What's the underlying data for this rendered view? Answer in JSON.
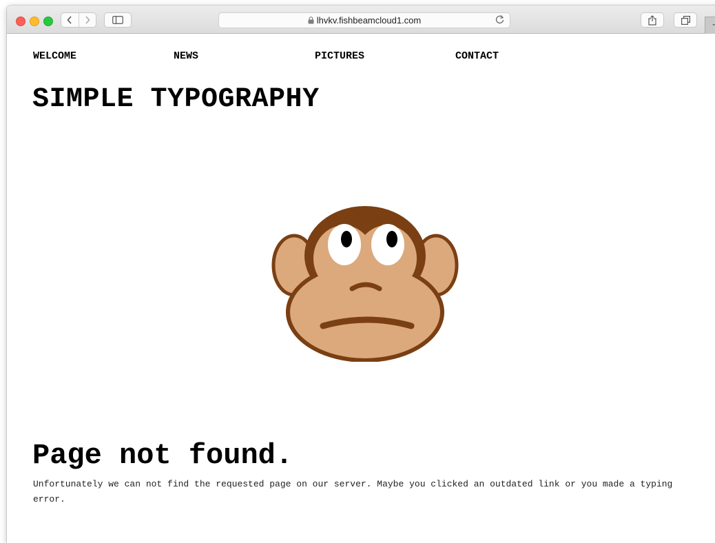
{
  "browser": {
    "url": "lhvkv.fishbeamcloud1.com",
    "new_tab_label": "+"
  },
  "nav": {
    "items": [
      {
        "label": "WELCOME"
      },
      {
        "label": "NEWS"
      },
      {
        "label": "PICTURES"
      },
      {
        "label": "CONTACT"
      }
    ]
  },
  "site_title": "SIMPLE TYPOGRAPHY",
  "error": {
    "heading": "Page not found.",
    "message": "Unfortunately we can not find the requested page on our server. Maybe you clicked an outdated link or you made a typing error."
  },
  "illustration": {
    "icon": "sad-monkey-icon",
    "colors": {
      "outline": "#7a3f12",
      "skin": "#dca97c",
      "eye_white": "#ffffff",
      "pupil": "#000000"
    }
  }
}
